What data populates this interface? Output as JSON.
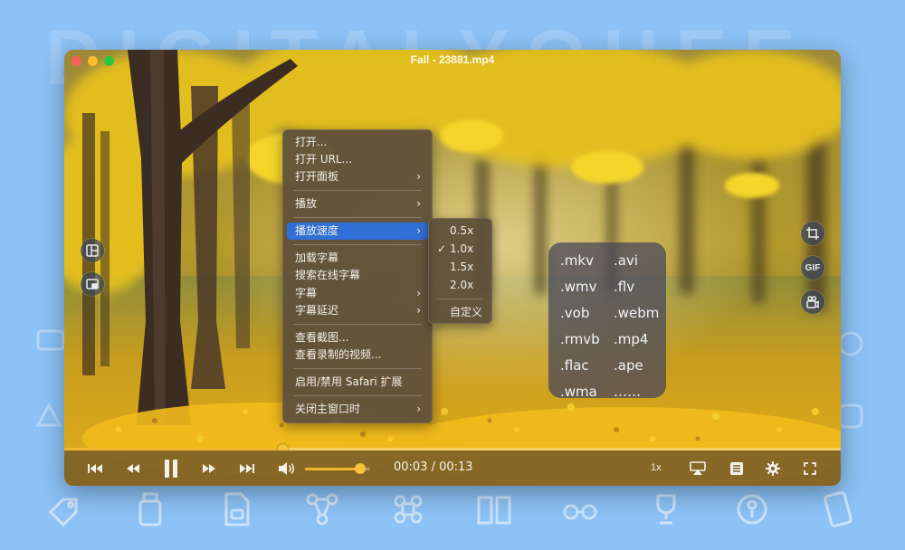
{
  "watermark": "DIGITALYOHEE",
  "window": {
    "title": "Fall - 23881.mp4"
  },
  "context_menu": {
    "items": [
      {
        "label": "打开...",
        "submenu": false
      },
      {
        "label": "打开 URL...",
        "submenu": false
      },
      {
        "label": "打开面板",
        "submenu": true
      },
      {
        "label": "播放",
        "submenu": true
      },
      {
        "label": "播放速度",
        "submenu": true,
        "active": true
      },
      {
        "label": "加载字幕",
        "submenu": false
      },
      {
        "label": "搜索在线字幕",
        "submenu": false
      },
      {
        "label": "字幕",
        "submenu": true
      },
      {
        "label": "字幕延迟",
        "submenu": true
      },
      {
        "label": "查看截图...",
        "submenu": false
      },
      {
        "label": "查看录制的视频...",
        "submenu": false
      },
      {
        "label": "启用/禁用 Safari 扩展",
        "submenu": false
      },
      {
        "label": "关闭主窗口时",
        "submenu": true
      }
    ],
    "arrow_glyph": "›"
  },
  "speed_submenu": {
    "items": [
      {
        "label": "0.5x",
        "checked": false
      },
      {
        "label": "1.0x",
        "checked": true
      },
      {
        "label": "1.5x",
        "checked": false
      },
      {
        "label": "2.0x",
        "checked": false
      },
      {
        "label": "自定义",
        "checked": false
      }
    ],
    "check_glyph": "✓"
  },
  "formats": [
    ".mkv",
    ".avi",
    ".wmv",
    ".flv",
    ".vob",
    ".webm",
    ".rmvb",
    ".mp4",
    ".flac",
    ".ape",
    ".wma",
    "……"
  ],
  "side_buttons": {
    "left": [
      "layout-panel-icon",
      "picture-in-picture-icon"
    ],
    "right": [
      "crop-screenshot-icon",
      "gif-icon",
      "record-video-icon"
    ],
    "gif_label": "GIF"
  },
  "player": {
    "progress_fraction": 0.281,
    "volume_fraction": 0.85,
    "time": "00:03 / 00:13",
    "speed": "1x",
    "accent_color": "#f3b52c"
  },
  "controls": [
    "skip-to-start-icon",
    "rewind-icon",
    "pause-icon",
    "fast-forward-icon",
    "skip-to-end-icon",
    "volume-icon",
    "airplay-icon",
    "playlist-icon",
    "settings-icon",
    "fullscreen-icon"
  ]
}
